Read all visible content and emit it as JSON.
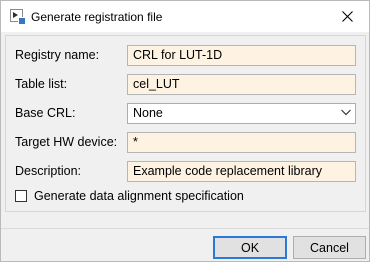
{
  "window": {
    "title": "Generate registration file",
    "app_icon": "simulink-dialog-icon",
    "close_icon": "close-icon"
  },
  "form": {
    "registry_name": {
      "label": "Registry name:",
      "value": "CRL for LUT-1D"
    },
    "table_list": {
      "label": "Table list:",
      "value": "cel_LUT"
    },
    "base_crl": {
      "label": "Base CRL:",
      "value": "None",
      "icon": "chevron-down-icon"
    },
    "target_hw": {
      "label": "Target HW device:",
      "value": "*"
    },
    "description": {
      "label": "Description:",
      "value": "Example code replacement library"
    },
    "alignment": {
      "label": "Generate data alignment specification",
      "checked": false
    }
  },
  "buttons": {
    "ok": "OK",
    "cancel": "Cancel"
  },
  "colors": {
    "field_background": "#fef3e3",
    "focus_border": "#2b78d6",
    "dialog_background": "#f0f0f0"
  }
}
